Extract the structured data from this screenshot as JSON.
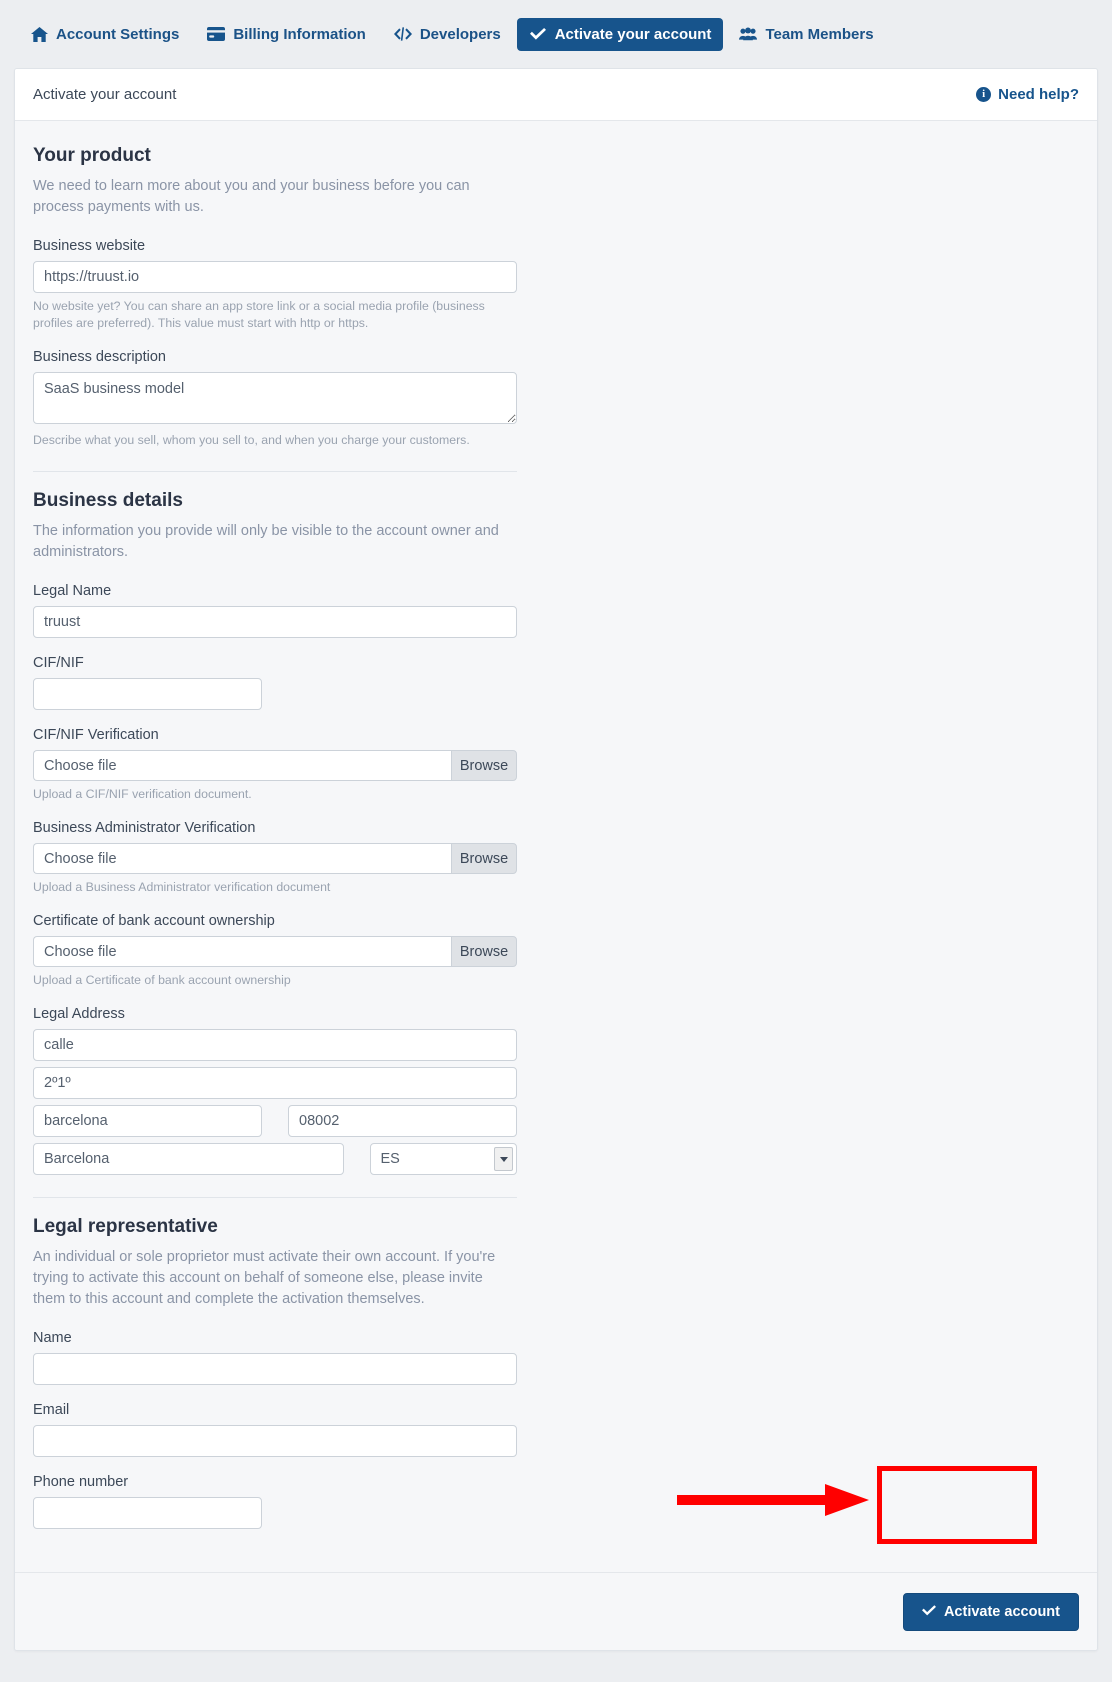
{
  "nav": {
    "items": [
      {
        "label": "Account Settings",
        "icon": "home-icon",
        "active": false
      },
      {
        "label": "Billing Information",
        "icon": "credit-card-icon",
        "active": false
      },
      {
        "label": "Developers",
        "icon": "code-icon",
        "active": false
      },
      {
        "label": "Activate your account",
        "icon": "check-icon",
        "active": true
      },
      {
        "label": "Team Members",
        "icon": "users-icon",
        "active": false
      }
    ]
  },
  "card": {
    "header_title": "Activate your account",
    "need_help_label": "Need help?",
    "need_help_icon": "info-circle-icon"
  },
  "your_product": {
    "title": "Your product",
    "description": "We need to learn more about you and your business before you can process payments with us.",
    "business_website": {
      "label": "Business website",
      "value": "https://truust.io",
      "help": "No website yet? You can share an app store link or a social media profile (business profiles are preferred). This value must start with http or https."
    },
    "business_description": {
      "label": "Business description",
      "value": "SaaS business model",
      "help": "Describe what you sell, whom you sell to, and when you charge your customers."
    }
  },
  "business_details": {
    "title": "Business details",
    "description": "The information you provide will only be visible to the account owner and administrators.",
    "legal_name": {
      "label": "Legal Name",
      "value": "truust"
    },
    "cif_nif": {
      "label": "CIF/NIF",
      "value": ""
    },
    "cif_nif_verification": {
      "label": "CIF/NIF Verification",
      "file_placeholder": "Choose file",
      "browse_label": "Browse",
      "help": "Upload a CIF/NIF verification document."
    },
    "business_admin_verification": {
      "label": "Business Administrator Verification",
      "file_placeholder": "Choose file",
      "browse_label": "Browse",
      "help": "Upload a Business Administrator verification document"
    },
    "bank_certificate": {
      "label": "Certificate of bank account ownership",
      "file_placeholder": "Choose file",
      "browse_label": "Browse",
      "help": "Upload a Certificate of bank account ownership"
    },
    "legal_address": {
      "label": "Legal Address",
      "line1": "calle",
      "line2": "2º1º",
      "city": "barcelona",
      "postal_code": "08002",
      "state": "Barcelona",
      "country": "ES"
    }
  },
  "legal_representative": {
    "title": "Legal representative",
    "description": "An individual or sole proprietor must activate their own account. If you're trying to activate this account on behalf of someone else, please invite them to this account and complete the activation themselves.",
    "name": {
      "label": "Name",
      "value": ""
    },
    "email": {
      "label": "Email",
      "value": ""
    },
    "phone": {
      "label": "Phone number",
      "value": ""
    }
  },
  "footer": {
    "activate_button": "Activate account",
    "activate_icon": "check-icon"
  },
  "annotation": {
    "highlight_color": "#ff0000",
    "arrow": "points-right-to-activate-account-button"
  },
  "colors": {
    "accent": "#17548c",
    "page_bg": "#eceef1",
    "card_bg": "#f6f7f9",
    "muted_text": "#8a94a6"
  }
}
